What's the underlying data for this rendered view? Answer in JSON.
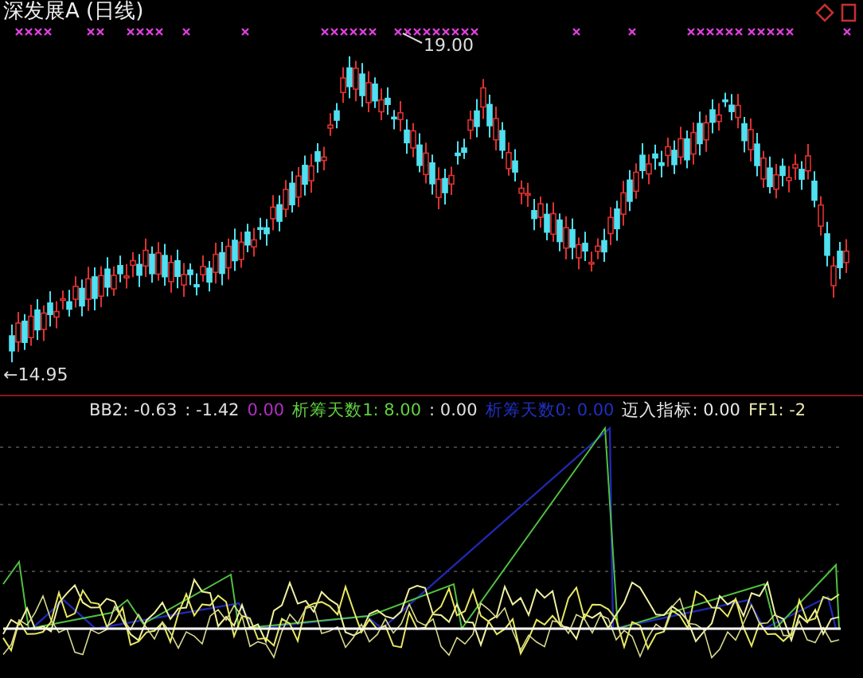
{
  "window": {
    "title": "深发展A (日线)"
  },
  "price_chart": {
    "high_label": "19.00",
    "low_label": "←14.95"
  },
  "indicator_legend": [
    {
      "text": "BB2: -0.63",
      "color": "#e0e0e0"
    },
    {
      "text": ": -1.42",
      "color": "#e0e0e0"
    },
    {
      "text": "0.00",
      "color": "#b030c0"
    },
    {
      "text": "析筹天数1: 8.00",
      "color": "#60d040"
    },
    {
      "text": ": 0.00",
      "color": "#e0e0e0"
    },
    {
      "text": "析筹天数0: 0.00",
      "color": "#2030c0"
    },
    {
      "text": "迈入指标: 0.00",
      "color": "#e8e8e8"
    },
    {
      "text": "FF1: -2",
      "color": "#e8e8b0"
    }
  ]
}
